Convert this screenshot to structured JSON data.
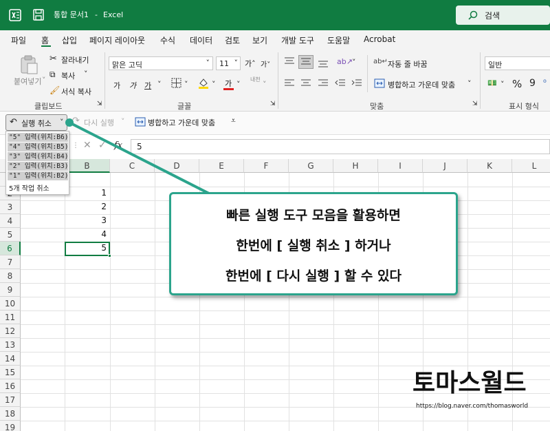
{
  "titlebar": {
    "doc_title": "통합 문서1",
    "separator": "-",
    "app_name": "Excel",
    "search_placeholder": "검색"
  },
  "menu": {
    "items": [
      "파일",
      "홈",
      "삽입",
      "페이지 레이아웃",
      "수식",
      "데이터",
      "검토",
      "보기",
      "개발 도구",
      "도움말",
      "Acrobat"
    ],
    "active": "홈"
  },
  "ribbon": {
    "clipboard": {
      "paste_label": "붙여넣기",
      "cut_label": "잘라내기",
      "copy_label": "복사",
      "format_painter_label": "서식 복사",
      "group_label": "클립보드"
    },
    "font": {
      "font_name": "맑은 고딕",
      "font_size": "11",
      "grow_label": "가˄",
      "shrink_label": "가˅",
      "bold": "가",
      "italic": "가",
      "underline": "가",
      "font_color_label": "가",
      "phonetic_label": "내천",
      "group_label": "글꼴"
    },
    "alignment": {
      "wrap_text_label": "자동 줄 바꿈",
      "merge_center_label": "병합하고 가운데 맞춤",
      "group_label": "맞춤"
    },
    "number": {
      "format_value": "일반",
      "percent": "%",
      "comma": "9",
      "group_label": "표시 형식"
    }
  },
  "qat": {
    "undo_label": "실행 취소",
    "redo_label": "다시 실행",
    "merge_center_label": "병합하고 가운데 맞춤",
    "undo_history": [
      "\"5\" 입력(위치:B6)",
      "\"4\" 입력(위치:B5)",
      "\"3\" 입력(위치:B4)",
      "\"2\" 입력(위치:B3)",
      "\"1\" 입력(위치:B2)"
    ],
    "undo_summary": "5개 작업 취소"
  },
  "formula_bar": {
    "fx_label": "fx",
    "value": "5"
  },
  "grid": {
    "columns": [
      "B",
      "C",
      "D",
      "E",
      "F",
      "G",
      "H",
      "I",
      "J",
      "K",
      "L"
    ],
    "rows": [
      "2",
      "3",
      "4",
      "5",
      "6",
      "7",
      "8",
      "9",
      "10",
      "11",
      "12",
      "13",
      "14",
      "15",
      "16",
      "17",
      "18",
      "19"
    ],
    "b_values": [
      "1",
      "2",
      "3",
      "4",
      "5"
    ],
    "active_cell": "B6"
  },
  "callout": {
    "lines": [
      "빠른 실행 도구 모음을 활용하면",
      "한번에 [ 실행 취소 ] 하거나",
      "한번에 [ 다시 실행 ] 할 수 있다"
    ],
    "border_color": "#2ba48c"
  },
  "watermark": {
    "title": "토마스월드",
    "url": "https://blog.naver.com/thomasworld"
  },
  "colors": {
    "excel_green": "#107c41",
    "ribbon_bg": "#f3f3f3",
    "callout_border": "#2ba48c"
  }
}
